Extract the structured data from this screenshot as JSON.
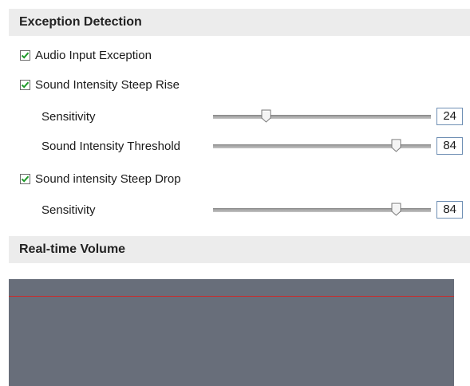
{
  "exception_detection": {
    "title": "Exception Detection",
    "audio_input_exception": {
      "label": "Audio Input Exception",
      "checked": true
    },
    "steep_rise": {
      "label": "Sound Intensity Steep Rise",
      "checked": true,
      "sensitivity": {
        "label": "Sensitivity",
        "value": "24",
        "min": 0,
        "max": 100
      },
      "threshold": {
        "label": "Sound Intensity Threshold",
        "value": "84",
        "min": 0,
        "max": 100
      }
    },
    "steep_drop": {
      "label": "Sound intensity Steep Drop",
      "checked": true,
      "sensitivity": {
        "label": "Sensitivity",
        "value": "84",
        "min": 0,
        "max": 100
      }
    }
  },
  "realtime_volume": {
    "title": "Real-time Volume",
    "threshold_line_color": "#cc2a2a",
    "panel_color": "#686e7a"
  }
}
